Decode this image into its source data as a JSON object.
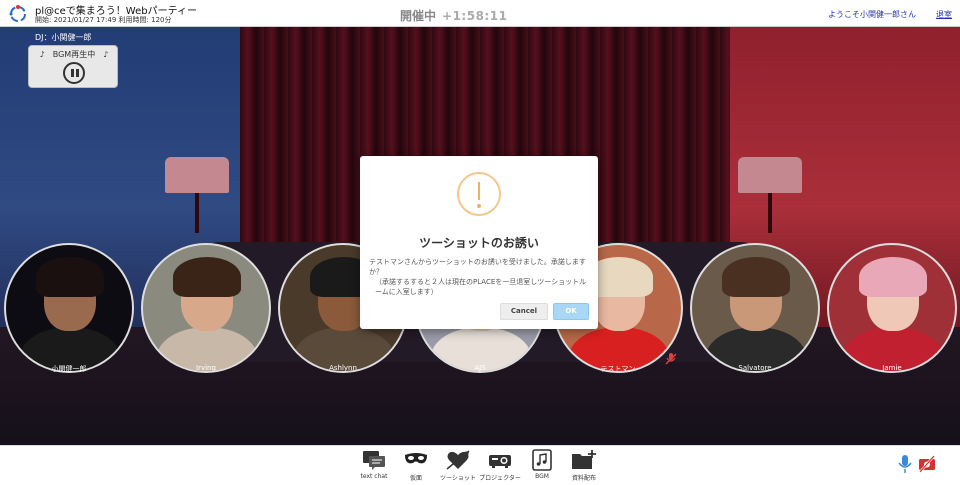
{
  "header": {
    "app_title": "pl@ceで集まろう！Webパーティー",
    "meta": "開始: 2021/01/27 17:49  利用時間: 120分",
    "status_label": "開催中",
    "timer": "+1:58:11",
    "welcome": "ようこそ小関健一郎さん",
    "logout": "退室"
  },
  "dj": {
    "label": "DJ：小関健一郎",
    "bgm_status": "♪　BGM再生中　♪"
  },
  "participants": [
    {
      "name": "小関健一郎",
      "skin": "#9a6a4e",
      "hair": "#1a1010",
      "shirt": "#1a1a1a",
      "bg": "#0c0c12"
    },
    {
      "name": "Irving",
      "skin": "#d8a88a",
      "hair": "#3a2418",
      "shirt": "#c8b8a8",
      "bg": "#8a8a7e"
    },
    {
      "name": "Ashlynn",
      "skin": "#8a5a3a",
      "hair": "#1a1a1a",
      "shirt": "#5a4a3a",
      "bg": "#4a3a2a"
    },
    {
      "name": "AJS",
      "skin": "#e0c0a8",
      "hair": "#c8a878",
      "shirt": "#e8e0d8",
      "bg": "#9a9aa8"
    },
    {
      "name": "テストマン",
      "skin": "#e8b8a0",
      "hair": "#e8d8c0",
      "shirt": "#d82020",
      "bg": "#b86848"
    },
    {
      "name": "Salvatore",
      "skin": "#c89878",
      "hair": "#4a3020",
      "shirt": "#2a2a2a",
      "bg": "#6a5a4a"
    },
    {
      "name": "Jamie",
      "skin": "#f0c8b8",
      "hair": "#e8a8b8",
      "shirt": "#c02030",
      "bg": "#a03038"
    }
  ],
  "modal": {
    "title": "ツーショットのお誘い",
    "message": "テストマンさんからツーショットのお誘いを受けました。承諾しますか？",
    "note": "（承諾するすると２人は現在のPLACEを一旦退室しツーショットルームに入室します）",
    "cancel_label": "Cancel",
    "ok_label": "OK"
  },
  "toolbar": {
    "items": [
      {
        "label": "text chat",
        "icon": "chat-icon"
      },
      {
        "label": "仮面",
        "icon": "mask-icon"
      },
      {
        "label": "ツーショット",
        "icon": "heart-arrow-icon"
      },
      {
        "label": "プロジェクター",
        "icon": "projector-icon"
      },
      {
        "label": "BGM",
        "icon": "music-note-icon"
      },
      {
        "label": "資料配布",
        "icon": "folder-add-icon"
      }
    ]
  },
  "colors": {
    "accent": "#2233aa",
    "ok_button": "#a8d8f5",
    "alert": "#f0b060",
    "mic": "#3a8ad8",
    "camera_off": "#d83030"
  }
}
